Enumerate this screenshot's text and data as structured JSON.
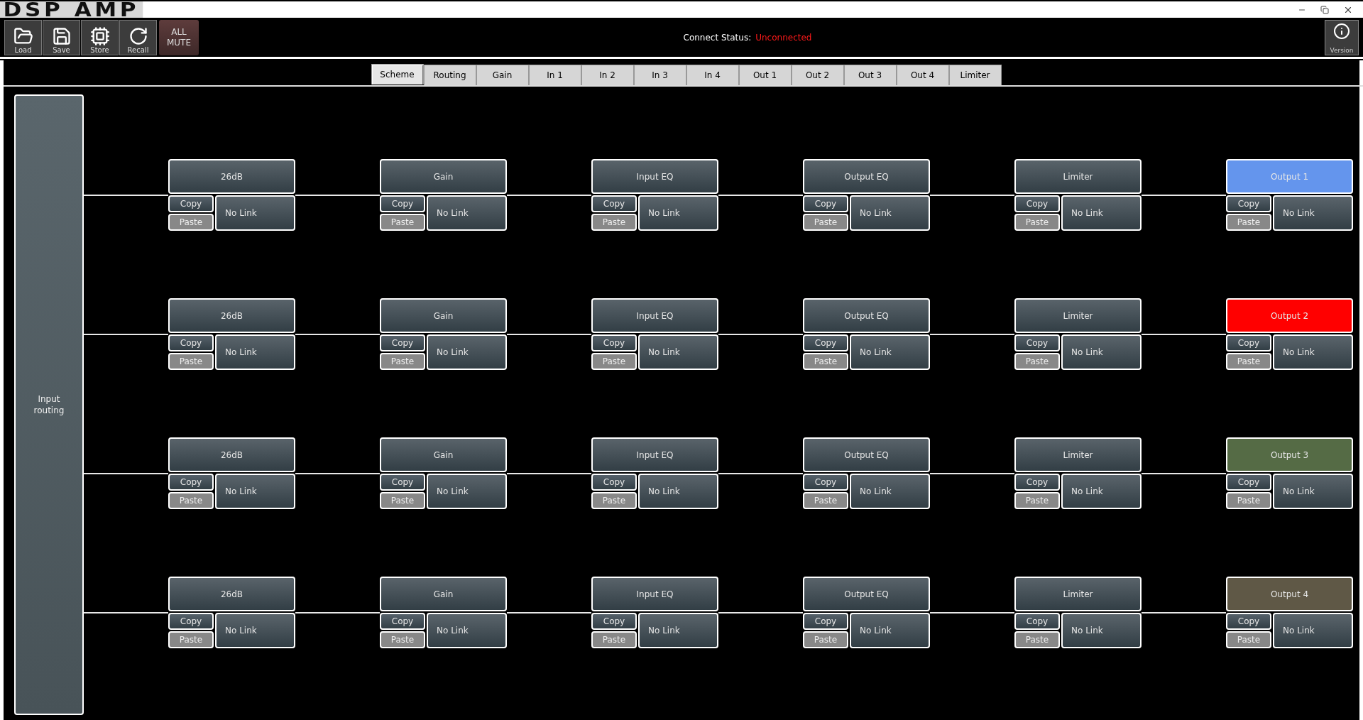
{
  "window": {
    "logo": "DSP AMP"
  },
  "toolbar": {
    "buttons": [
      {
        "label": "Load"
      },
      {
        "label": "Save"
      },
      {
        "label": "Store"
      },
      {
        "label": "Recall"
      }
    ],
    "mute_button": "ALL MUTE",
    "connect_status": {
      "label": "Connect Status:",
      "value": "Unconnected"
    },
    "version_button": "Version"
  },
  "tabs": [
    {
      "label": "Scheme",
      "selected": true
    },
    {
      "label": "Routing",
      "selected": false
    },
    {
      "label": "Gain",
      "selected": false
    },
    {
      "label": "In 1",
      "selected": false
    },
    {
      "label": "In 2",
      "selected": false
    },
    {
      "label": "In 3",
      "selected": false
    },
    {
      "label": "In 4",
      "selected": false
    },
    {
      "label": "Out 1",
      "selected": false
    },
    {
      "label": "Out 2",
      "selected": false
    },
    {
      "label": "Out 3",
      "selected": false
    },
    {
      "label": "Out 4",
      "selected": false
    },
    {
      "label": "Limiter",
      "selected": false
    }
  ],
  "input_routing": "Input routing",
  "channels": [
    {
      "blocks": [
        {
          "title": "26dB",
          "copy": "Copy",
          "paste": "Paste",
          "link": "No Link"
        },
        {
          "title": "Gain",
          "copy": "Copy",
          "paste": "Paste",
          "link": "No Link"
        },
        {
          "title": "Input EQ",
          "copy": "Copy",
          "paste": "Paste",
          "link": "No Link"
        },
        {
          "title": "Output EQ",
          "copy": "Copy",
          "paste": "Paste",
          "link": "No Link"
        },
        {
          "title": "Limiter",
          "copy": "Copy",
          "paste": "Paste",
          "link": "No Link"
        },
        {
          "title": "Output 1",
          "copy": "Copy",
          "paste": "Paste",
          "link": "No Link",
          "color": "#6495ed"
        }
      ]
    },
    {
      "blocks": [
        {
          "title": "26dB",
          "copy": "Copy",
          "paste": "Paste",
          "link": "No Link"
        },
        {
          "title": "Gain",
          "copy": "Copy",
          "paste": "Paste",
          "link": "No Link"
        },
        {
          "title": "Input EQ",
          "copy": "Copy",
          "paste": "Paste",
          "link": "No Link"
        },
        {
          "title": "Output EQ",
          "copy": "Copy",
          "paste": "Paste",
          "link": "No Link"
        },
        {
          "title": "Limiter",
          "copy": "Copy",
          "paste": "Paste",
          "link": "No Link"
        },
        {
          "title": "Output 2",
          "copy": "Copy",
          "paste": "Paste",
          "link": "No Link",
          "color": "#ff0000"
        }
      ]
    },
    {
      "blocks": [
        {
          "title": "26dB",
          "copy": "Copy",
          "paste": "Paste",
          "link": "No Link"
        },
        {
          "title": "Gain",
          "copy": "Copy",
          "paste": "Paste",
          "link": "No Link"
        },
        {
          "title": "Input EQ",
          "copy": "Copy",
          "paste": "Paste",
          "link": "No Link"
        },
        {
          "title": "Output EQ",
          "copy": "Copy",
          "paste": "Paste",
          "link": "No Link"
        },
        {
          "title": "Limiter",
          "copy": "Copy",
          "paste": "Paste",
          "link": "No Link"
        },
        {
          "title": "Output 3",
          "copy": "Copy",
          "paste": "Paste",
          "link": "No Link",
          "color": "#556b45"
        }
      ]
    },
    {
      "blocks": [
        {
          "title": "26dB",
          "copy": "Copy",
          "paste": "Paste",
          "link": "No Link"
        },
        {
          "title": "Gain",
          "copy": "Copy",
          "paste": "Paste",
          "link": "No Link"
        },
        {
          "title": "Input EQ",
          "copy": "Copy",
          "paste": "Paste",
          "link": "No Link"
        },
        {
          "title": "Output EQ",
          "copy": "Copy",
          "paste": "Paste",
          "link": "No Link"
        },
        {
          "title": "Limiter",
          "copy": "Copy",
          "paste": "Paste",
          "link": "No Link"
        },
        {
          "title": "Output 4",
          "copy": "Copy",
          "paste": "Paste",
          "link": "No Link",
          "color": "#5f5846"
        }
      ]
    }
  ]
}
